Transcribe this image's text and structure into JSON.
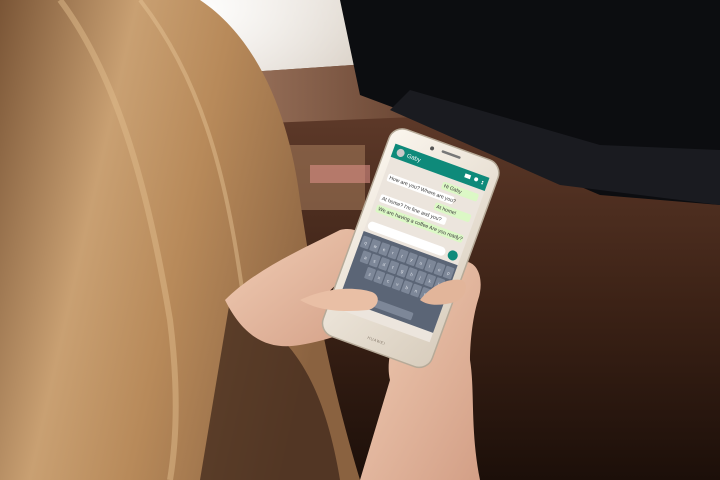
{
  "scene": {
    "description_type": "photo",
    "colors": {
      "wall_light": "#d9cfc4",
      "cabinet": "#5a3422",
      "tv": "#0b0c0f",
      "hair": "#c99a6a",
      "skin": "#e8c0a6",
      "phone_body": "#efe7dc",
      "whatsapp_bar": "#0e8a7a",
      "chat_bg": "#ece5dd",
      "bubble_out": "#dcf8c6",
      "bubble_in": "#ffffff",
      "keyboard": "#5b6576"
    }
  },
  "phone": {
    "chat_title": "Gaby",
    "messages": [
      {
        "side": "in",
        "text": "Hi Gaby"
      },
      {
        "side": "out",
        "text": "How are you? Where are you?"
      },
      {
        "side": "in",
        "text": "At home!"
      },
      {
        "side": "out",
        "text": "At home? I'm fine and you?"
      },
      {
        "side": "in",
        "text": "We are having a coffee Are you ready?"
      }
    ],
    "keyboard_rows": [
      [
        "q",
        "w",
        "e",
        "r",
        "t",
        "y",
        "u",
        "i",
        "o",
        "p"
      ],
      [
        "a",
        "s",
        "d",
        "f",
        "g",
        "h",
        "j",
        "k",
        "l"
      ],
      [
        "z",
        "x",
        "c",
        "v",
        "b",
        "n",
        "m"
      ]
    ],
    "brand": "HUAWEI"
  }
}
